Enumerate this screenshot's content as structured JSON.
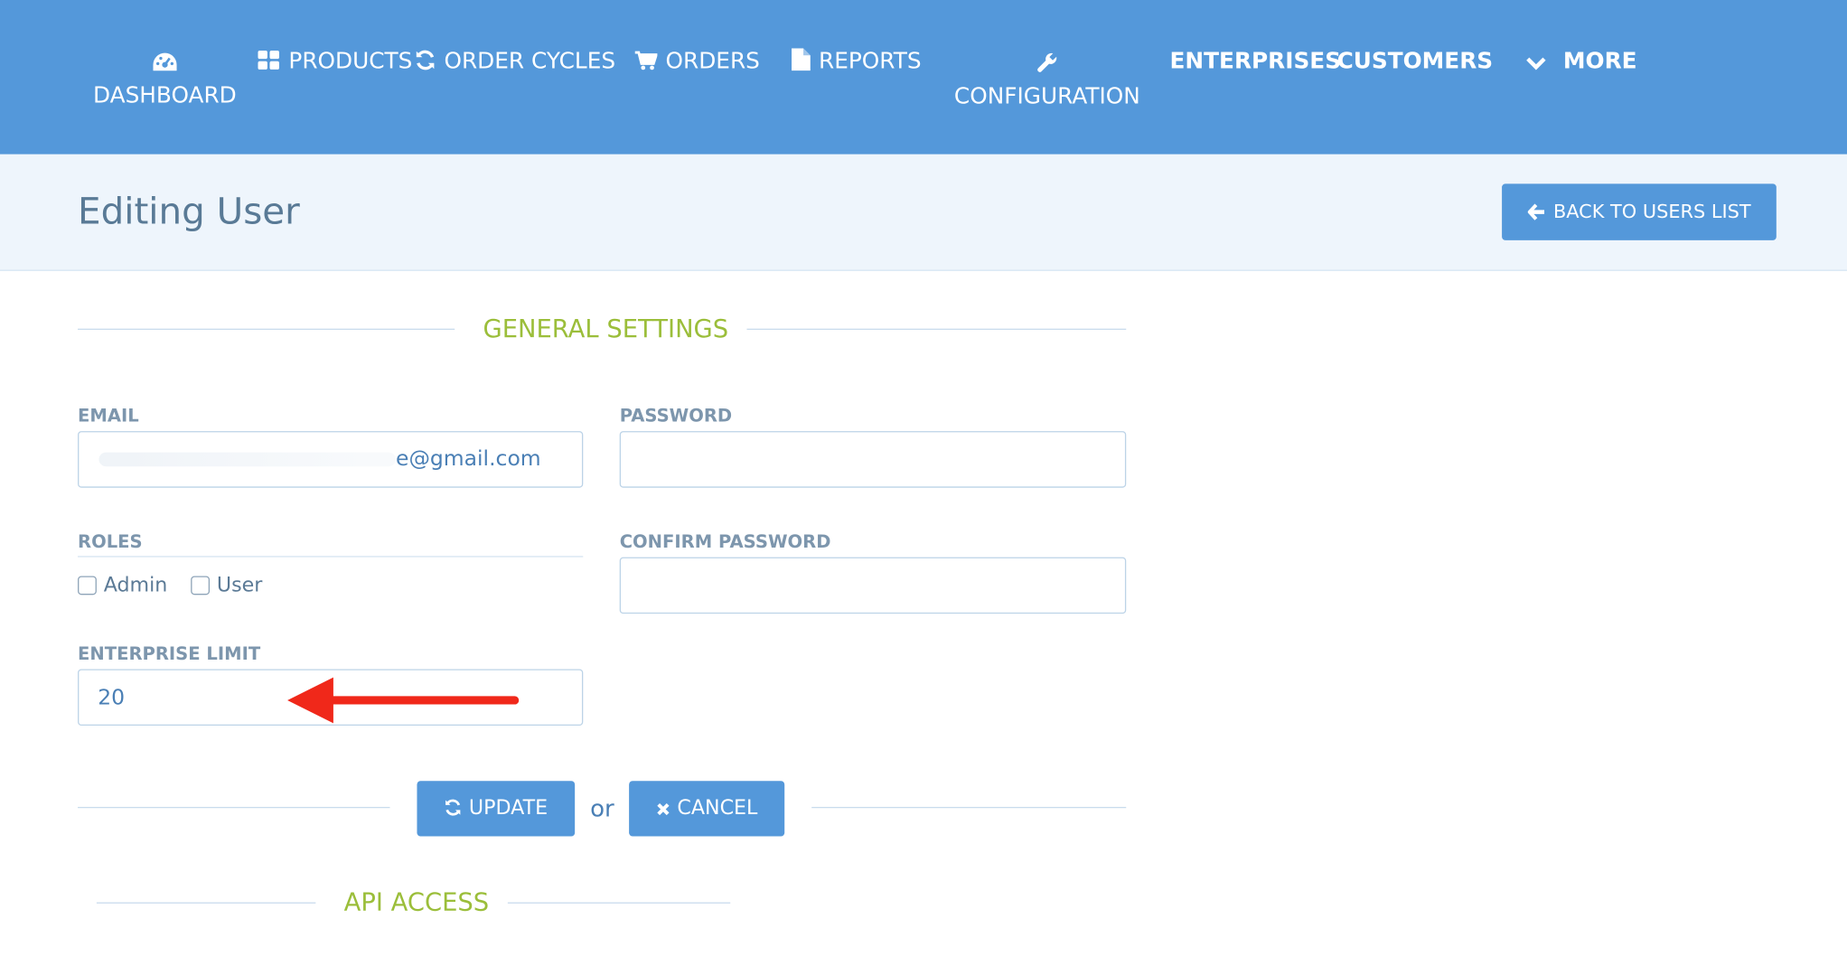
{
  "nav": {
    "items": [
      {
        "label": "DASHBOARD",
        "icon": "dashboard-icon"
      },
      {
        "label": "PRODUCTS",
        "icon": "grid-icon"
      },
      {
        "label": "ORDER CYCLES",
        "icon": "refresh-icon"
      },
      {
        "label": "ORDERS",
        "icon": "cart-icon"
      },
      {
        "label": "REPORTS",
        "icon": "file-icon"
      },
      {
        "label": "CONFIGURATION",
        "icon": "wrench-icon"
      },
      {
        "label": "ENTERPRISES",
        "icon": ""
      },
      {
        "label": "CUSTOMERS",
        "icon": ""
      },
      {
        "label": "MORE",
        "icon": "chevron-down-icon"
      }
    ]
  },
  "header": {
    "title": "Editing User",
    "back_label": "BACK TO USERS LIST"
  },
  "general": {
    "section_title": "GENERAL SETTINGS",
    "email_label": "EMAIL",
    "email_value": "e@gmail.com",
    "password_label": "PASSWORD",
    "password_value": "",
    "roles_label": "ROLES",
    "roles": [
      {
        "label": "Admin",
        "checked": false
      },
      {
        "label": "User",
        "checked": false
      }
    ],
    "confirm_label": "CONFIRM PASSWORD",
    "confirm_value": "",
    "limit_label": "ENTERPRISE LIMIT",
    "limit_value": "20"
  },
  "actions": {
    "update_label": "UPDATE",
    "or_label": "or",
    "cancel_label": "CANCEL"
  },
  "api": {
    "section_title": "API ACCESS"
  },
  "colors": {
    "primary": "#5498da",
    "accent": "#9bbe3a",
    "annotation": "#f0281a"
  }
}
